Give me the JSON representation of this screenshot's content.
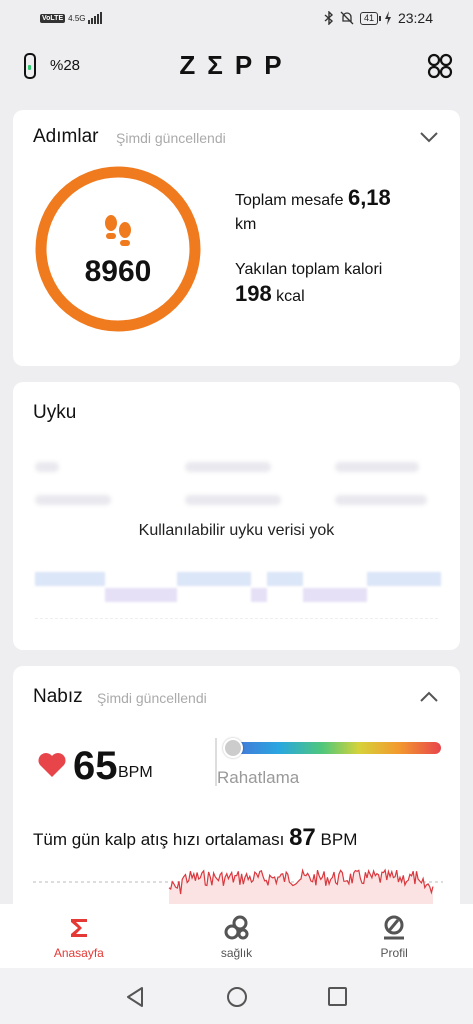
{
  "status_bar": {
    "volte": "VoLTE",
    "network": "4.5G",
    "battery": "41",
    "time": "23:24"
  },
  "header": {
    "band_battery": "%28",
    "logo": "ZΣPP"
  },
  "steps_card": {
    "title": "Adımlar",
    "updated": "Şimdi güncellendi",
    "steps": "8960",
    "distance_label": "Toplam mesafe",
    "distance_value": "6,18",
    "distance_unit": "km",
    "calories_label": "Yakılan toplam kalori",
    "calories_value": "198",
    "calories_unit": "kcal",
    "ring_color": "#f07a1e"
  },
  "sleep_card": {
    "title": "Uyku",
    "empty_message": "Kullanılabilir uyku verisi yok"
  },
  "heart_card": {
    "title": "Nabız",
    "updated": "Şimdi güncellendi",
    "bpm": "65",
    "bpm_unit": "BPM",
    "zone_label": "Rahatlama",
    "avg_label": "Tüm gün kalp atış hızı ortalaması",
    "avg_value": "87",
    "avg_unit": "BPM",
    "accent": "#e53935"
  },
  "bottom_nav": {
    "items": [
      {
        "label": "Anasayfa",
        "icon": "sigma-icon",
        "active": true
      },
      {
        "label": "sağlık",
        "icon": "health-icon",
        "active": false
      },
      {
        "label": "Profil",
        "icon": "profile-icon",
        "active": false
      }
    ]
  }
}
